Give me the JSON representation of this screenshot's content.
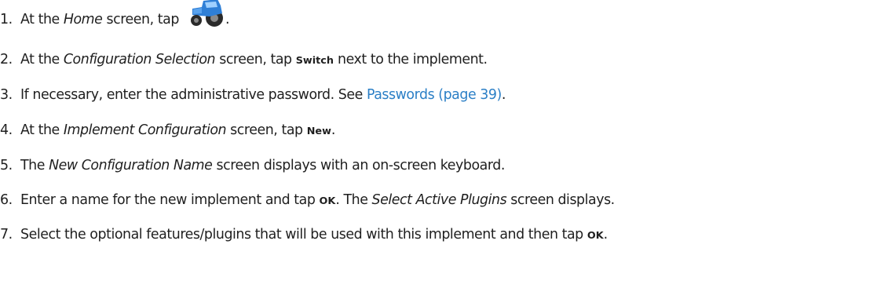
{
  "steps": [
    {
      "number": "1.",
      "parts": [
        {
          "text": "At the ",
          "style": "normal"
        },
        {
          "text": "Home",
          "style": "italic"
        },
        {
          "text": " screen, tap ",
          "style": "normal"
        },
        {
          "icon": "tractor-icon"
        },
        {
          "text": ".",
          "style": "normal"
        }
      ]
    },
    {
      "number": "2.",
      "parts": [
        {
          "text": "At the ",
          "style": "normal"
        },
        {
          "text": "Configuration Selection",
          "style": "italic"
        },
        {
          "text": " screen, tap ",
          "style": "normal"
        },
        {
          "text": "Switch",
          "style": "bold"
        },
        {
          "text": " next to the implement.",
          "style": "normal"
        }
      ]
    },
    {
      "number": "3.",
      "parts": [
        {
          "text": "If necessary, enter the administrative password. See ",
          "style": "normal"
        },
        {
          "text": "Passwords (page 39)",
          "style": "link"
        },
        {
          "text": ".",
          "style": "normal"
        }
      ]
    },
    {
      "number": "4.",
      "parts": [
        {
          "text": "At the ",
          "style": "normal"
        },
        {
          "text": "Implement Configuration",
          "style": "italic"
        },
        {
          "text": " screen, tap ",
          "style": "normal"
        },
        {
          "text": "New",
          "style": "bold"
        },
        {
          "text": ".",
          "style": "normal"
        }
      ]
    },
    {
      "number": "5.",
      "parts": [
        {
          "text": "The ",
          "style": "normal"
        },
        {
          "text": "New Configuration Name",
          "style": "italic"
        },
        {
          "text": " screen displays with an on-screen keyboard.",
          "style": "normal"
        }
      ]
    },
    {
      "number": "6.",
      "parts": [
        {
          "text": "Enter a name for the new implement and tap ",
          "style": "normal"
        },
        {
          "text": "OK",
          "style": "bold"
        },
        {
          "text": ". The ",
          "style": "normal"
        },
        {
          "text": "Select Active Plugins",
          "style": "italic"
        },
        {
          "text": " screen displays.",
          "style": "normal"
        }
      ]
    },
    {
      "number": "7.",
      "parts": [
        {
          "text": "Select the optional features/plugins that will be used with this implement and then tap ",
          "style": "normal"
        },
        {
          "text": "OK",
          "style": "bold"
        },
        {
          "text": ".",
          "style": "normal"
        }
      ]
    }
  ],
  "colors": {
    "text": "#1f1f1f",
    "link": "#2b7fc6",
    "tractor_body": "#2f7fd6",
    "tractor_tires": "#2a2a2a"
  }
}
